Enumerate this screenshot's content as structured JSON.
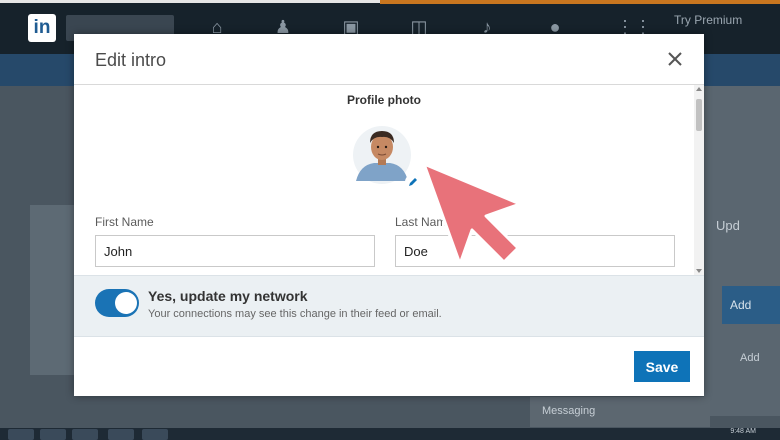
{
  "background": {
    "nav_premium_line1": "Try Premium",
    "right_panel_text": "Upd",
    "right_button_text": "Add",
    "right_small_text": "Add",
    "bottom_strip_text": "Messaging",
    "taskbar_time": "9:48 AM"
  },
  "modal": {
    "title": "Edit intro",
    "close_icon": "close-icon",
    "profile_photo_label": "Profile photo",
    "first_name_label": "First Name",
    "first_name_value": "John",
    "last_name_label": "Last Name",
    "last_name_value": "Doe",
    "update_network": {
      "enabled": true,
      "title": "Yes, update my network",
      "description": "Your connections may see this change in their feed or email."
    },
    "save_label": "Save"
  },
  "colors": {
    "primary": "#0e73b8",
    "toggle_on": "#1a73b5",
    "pointer_arrow": "#e8727a",
    "nav_bg": "#16222b"
  }
}
